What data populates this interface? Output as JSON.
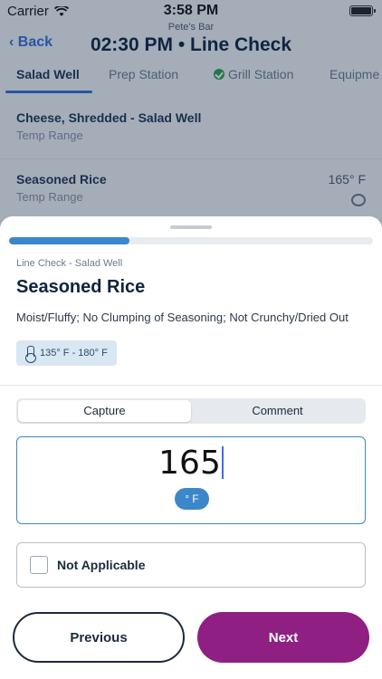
{
  "status_bar": {
    "carrier": "Carrier",
    "time": "3:58 PM",
    "subtitle": "Pete's Bar"
  },
  "nav": {
    "back_label": "Back",
    "title": "02:30 PM • Line Check"
  },
  "tabs": [
    {
      "label": "Salad Well",
      "active": true
    },
    {
      "label": "Prep Station",
      "active": false
    },
    {
      "label": "Grill Station",
      "active": false,
      "status": "complete"
    },
    {
      "label": "Equipme",
      "active": false
    }
  ],
  "rows": [
    {
      "name": "Cheese, Shredded - Salad Well",
      "sub": "Temp Range",
      "value": ""
    },
    {
      "name": "Seasoned Rice",
      "sub": "Temp Range",
      "value": "165° F",
      "has_comment": true
    }
  ],
  "sheet": {
    "progress": 0.33,
    "breadcrumb": "Line Check - Salad Well",
    "title": "Seasoned Rice",
    "description": "Moist/Fluffy; No Clumping of Seasoning; Not Crunchy/Dried Out",
    "range": "135° F - 180° F",
    "segment": {
      "capture": "Capture",
      "comment": "Comment",
      "active": "capture"
    },
    "capture_value": "165",
    "unit": "° F",
    "not_applicable_label": "Not Applicable",
    "not_applicable_checked": false,
    "previous_label": "Previous",
    "next_label": "Next"
  },
  "colors": {
    "accent": "#3b87c9",
    "next_button": "#8f1f83",
    "link": "#2f6fd6",
    "success": "#2aa04c"
  }
}
